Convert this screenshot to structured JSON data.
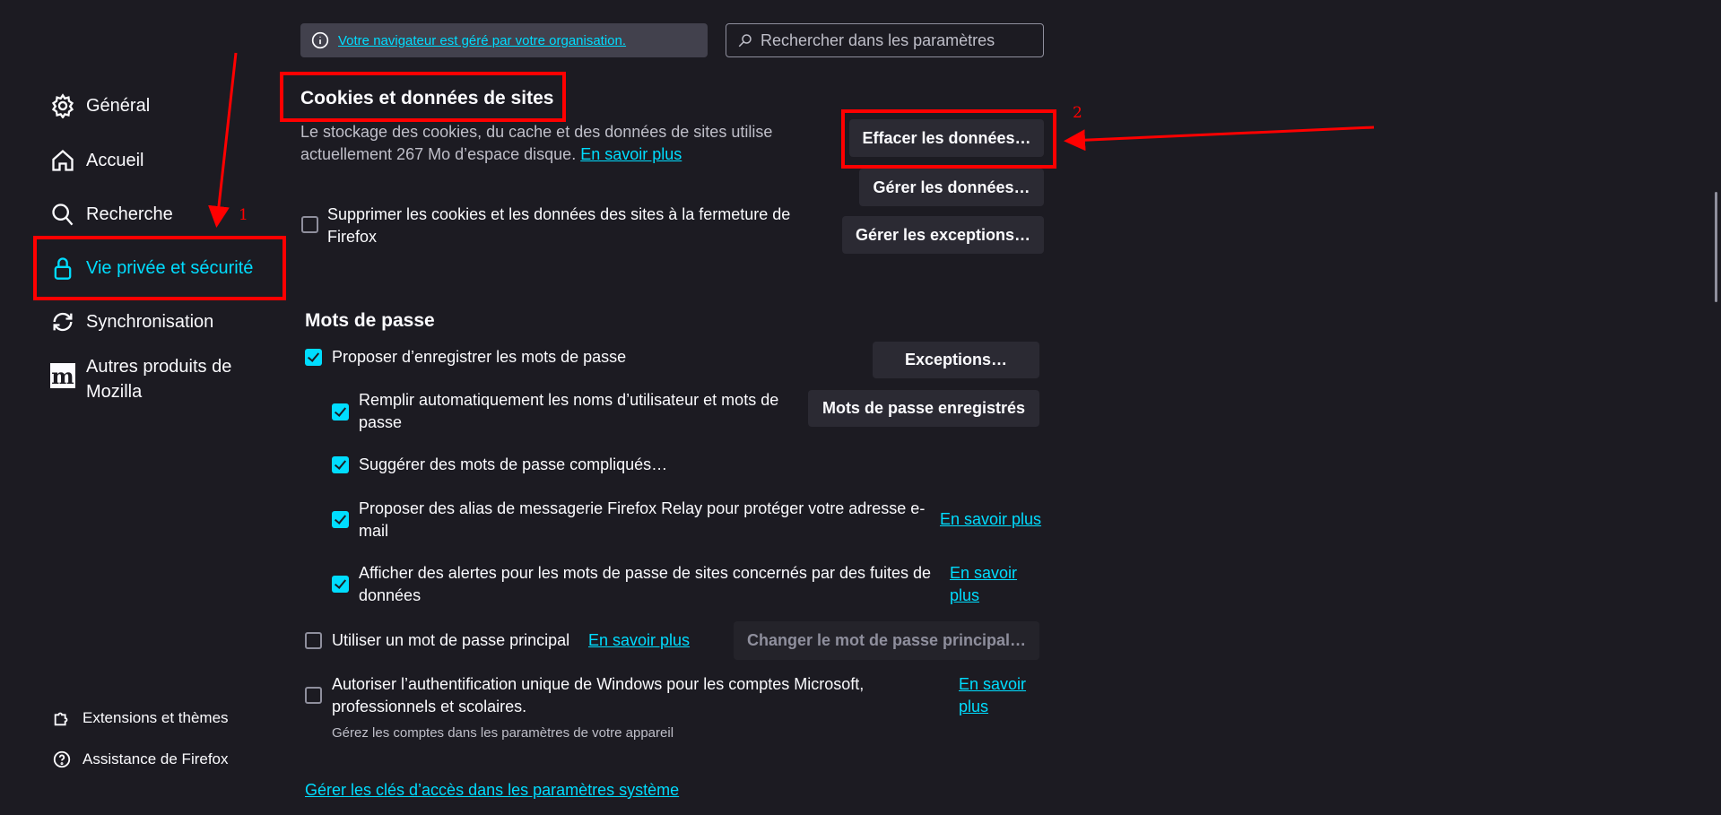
{
  "sidebar": {
    "items": [
      {
        "label": "Général",
        "icon": "gear-icon"
      },
      {
        "label": "Accueil",
        "icon": "home-icon"
      },
      {
        "label": "Recherche",
        "icon": "search-icon"
      },
      {
        "label": "Vie privée et sécurité",
        "icon": "lock-icon",
        "selected": true
      },
      {
        "label": "Synchronisation",
        "icon": "sync-icon"
      },
      {
        "label": "Autres produits de Mozilla",
        "icon": "mozilla-icon"
      }
    ],
    "footer": [
      {
        "label": "Extensions et thèmes",
        "icon": "puzzle-icon"
      },
      {
        "label": "Assistance de Firefox",
        "icon": "help-icon"
      }
    ]
  },
  "notice": {
    "text": "Votre navigateur est géré par votre organisation."
  },
  "search": {
    "placeholder": "Rechercher dans les paramètres"
  },
  "cookies": {
    "title": "Cookies et données de sites",
    "desc": "Le stockage des cookies, du cache et des données de sites utilise actuellement 267 Mo d’espace disque.",
    "learn_more": "En savoir plus",
    "clear_button": "Effacer les données…",
    "manage_button": "Gérer les données…",
    "exceptions_button": "Gérer les exceptions…",
    "delete_on_close": {
      "label": "Supprimer les cookies et les données des sites à la fermeture de Firefox",
      "checked": false
    }
  },
  "passwords": {
    "title": "Mots de passe",
    "ask_save": {
      "label": "Proposer d’enregistrer les mots de passe",
      "checked": true
    },
    "exceptions_button": "Exceptions…",
    "autofill": {
      "label": "Remplir automatiquement les noms d’utilisateur et mots de passe",
      "checked": true
    },
    "saved_button": "Mots de passe enregistrés",
    "suggest": {
      "label": "Suggérer des mots de passe compliqués…",
      "checked": true
    },
    "relay": {
      "label": "Proposer des alias de messagerie Firefox Relay pour protéger votre adresse e-mail",
      "checked": true,
      "link": "En savoir plus"
    },
    "breach": {
      "label": "Afficher des alertes pour les mots de passe de sites concernés par des fuites de données",
      "checked": true,
      "link": "En savoir plus"
    },
    "primary": {
      "label": "Utiliser un mot de passe principal",
      "checked": false,
      "link": "En savoir plus",
      "button": "Changer le mot de passe principal…"
    },
    "windows_sso": {
      "label": "Autoriser l’authentification unique de Windows pour les comptes Microsoft, professionnels et scolaires.",
      "checked": false,
      "link": "En savoir plus",
      "sub": "Gérez les comptes dans les paramètres de votre appareil"
    },
    "passkeys_link": "Gérer les clés d’accès dans les paramètres système"
  },
  "annotations": {
    "step1": "1",
    "step2": "2",
    "color": "#ff0000"
  },
  "colors": {
    "accent": "#00ddff",
    "background": "#1c1b22",
    "button": "#2b2a33"
  }
}
